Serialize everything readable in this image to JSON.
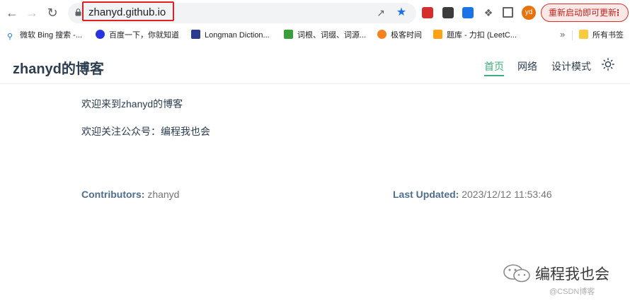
{
  "browser": {
    "url": "zhanyd.github.io",
    "relaunch_label": "重新启动即可更新",
    "profile_initials": "yd",
    "accent_colors": {
      "highlight_box": "#e02020",
      "relaunch": "#c5221f",
      "star": "#1a73e8"
    }
  },
  "bookmarks": {
    "items": [
      {
        "label": "微软 Bing 搜索 -...",
        "icon": "search-icon"
      },
      {
        "label": "百度一下，你就知道",
        "icon": "baidu-paw-icon"
      },
      {
        "label": "Longman Diction...",
        "icon": "longman-icon"
      },
      {
        "label": "词根、词缀、词源...",
        "icon": "book-icon"
      },
      {
        "label": "极客时间",
        "icon": "geek-time-icon"
      },
      {
        "label": "题库 - 力扣 (LeetC...",
        "icon": "leetcode-icon"
      }
    ],
    "more_label": "»",
    "all_bookmarks_label": "所有书签"
  },
  "site": {
    "title": "zhanyd的博客",
    "nav": [
      {
        "label": "首页",
        "active": true
      },
      {
        "label": "网络",
        "active": false
      },
      {
        "label": "设计模式",
        "active": false
      }
    ],
    "accent": "#3eaf7c"
  },
  "content": {
    "line1": "欢迎来到zhanyd的博客",
    "line2": "欢迎关注公众号：编程我也会"
  },
  "meta": {
    "contributors_label": "Contributors:",
    "contributors_value": "zhanyd",
    "updated_label": "Last Updated:",
    "updated_value": "2023/12/12 11:53:46"
  },
  "watermark": {
    "text": "编程我也会",
    "source": "@CSDN博客"
  }
}
